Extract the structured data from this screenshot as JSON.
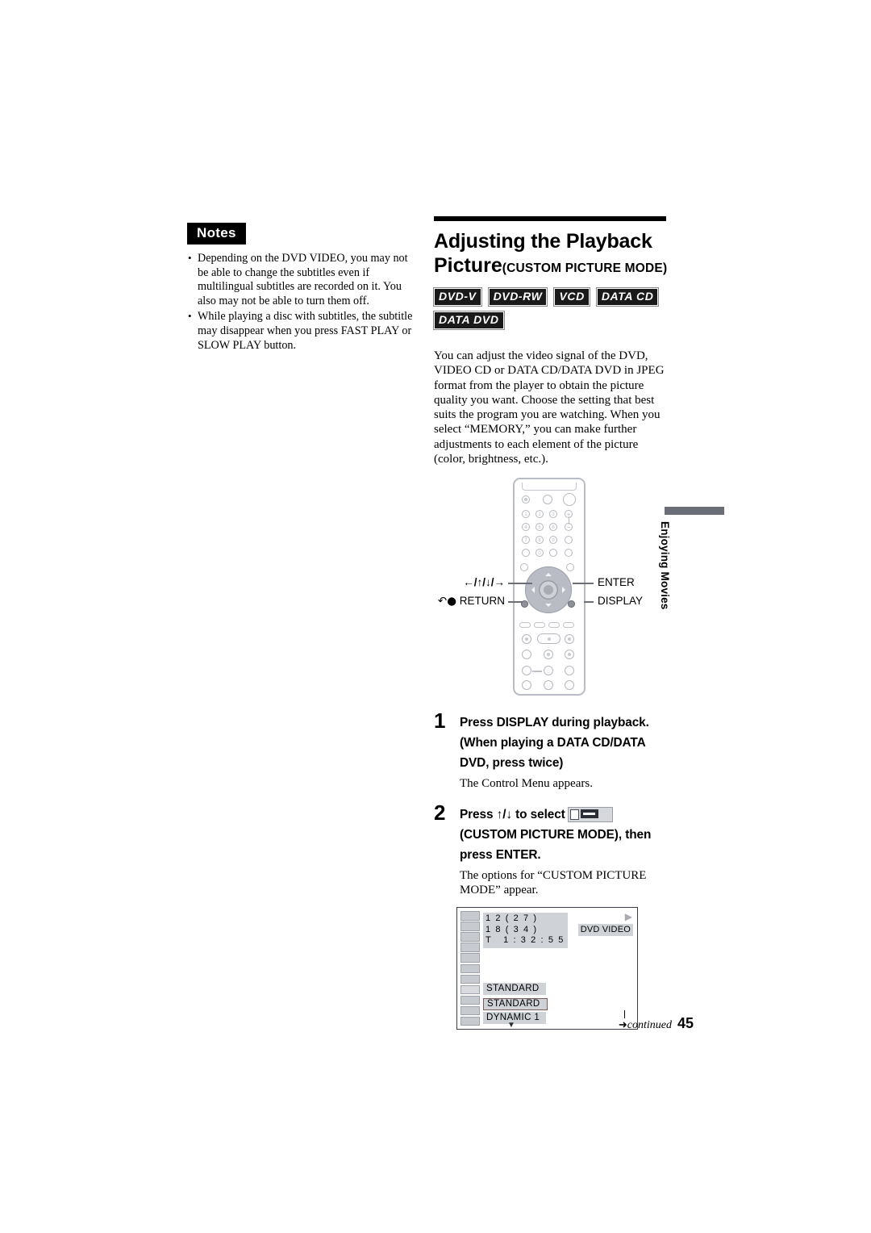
{
  "notes": {
    "badge_label": "Notes",
    "items": [
      "Depending on the DVD VIDEO, you may not be able to change the subtitles even if multilingual subtitles are recorded on it. You also may not be able to turn them off.",
      "While playing a disc with subtitles, the subtitle may disappear when you press FAST PLAY or SLOW PLAY button."
    ]
  },
  "section": {
    "title_line1": "Adjusting the Playback",
    "title_line2": "Picture",
    "title_paren": "(CUSTOM PICTURE MODE)",
    "badges": [
      "DVD-V",
      "DVD-RW",
      "VCD",
      "DATA CD",
      "DATA DVD"
    ],
    "intro": "You can adjust the video signal of the DVD, VIDEO CD or DATA CD/DATA DVD in JPEG format from the player to obtain the picture quality you want. Choose the setting that best suits the program you are watching. When you select “MEMORY,” you can make further adjustments to each element of the picture (color, brightness, etc.)."
  },
  "remote": {
    "callout_arrows": "←/↑/↓/→",
    "callout_return": "RETURN",
    "callout_return_icon": "return-arrow-icon",
    "callout_enter": "ENTER",
    "callout_display": "DISPLAY",
    "number_keys": [
      "1",
      "2",
      "3",
      "4",
      "5",
      "6",
      "7",
      "8",
      "9",
      "0"
    ],
    "volume_plus": "+",
    "volume_minus": "–"
  },
  "side_tab": {
    "label": "Enjoying Movies"
  },
  "steps": [
    {
      "number": "1",
      "heading_line1": "Press DISPLAY during playback.",
      "heading_line2": "(When playing a DATA CD/DATA",
      "heading_line3": "DVD, press twice)",
      "body": "The Control Menu appears."
    },
    {
      "number": "2",
      "heading_pre": "Press ↑/↓ to select",
      "heading_icon": "custom-picture-mode-icon",
      "heading_line2": "(CUSTOM PICTURE MODE), then",
      "heading_line3": "press ENTER.",
      "body": "The options for “CUSTOM PICTURE MODE” appear."
    }
  ],
  "osd": {
    "info_line1": "1 2 ( 2 7 )",
    "info_line2": "1 8 ( 3 4 )",
    "info_line3": "T   1 : 3 2 : 5 5",
    "play_icon": "▶",
    "disc_label": "DVD VIDEO",
    "current_option": "STANDARD",
    "selected_option": "STANDARD",
    "next_option": "DYNAMIC 1",
    "scroll_caret": "▼"
  },
  "footer": {
    "continued_arrow": "➜",
    "continued_label": "continued",
    "page_number": "45"
  },
  "colors": {
    "badge_bg": "#1a1a1a",
    "tab_bar": "#6b6e76",
    "osd_gray": "#cfd2d6",
    "remote_outline": "#b9bcc4"
  }
}
